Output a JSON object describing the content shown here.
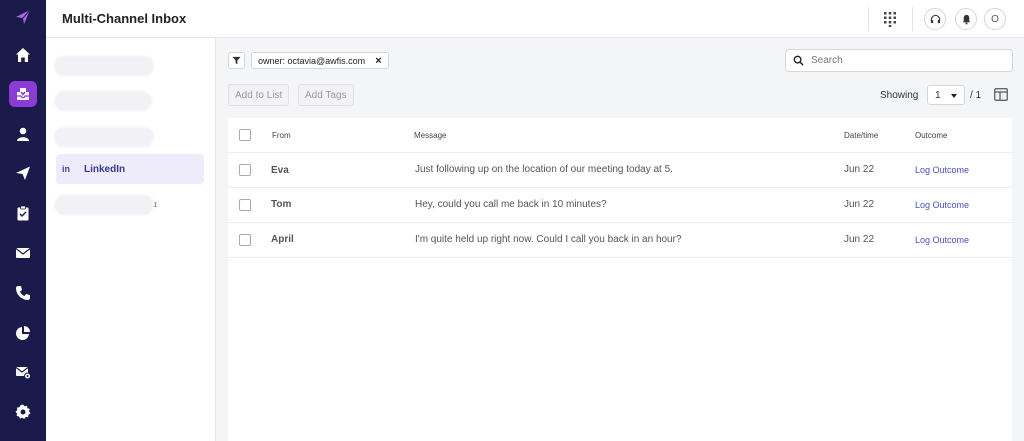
{
  "app": {
    "title": "Multi-Channel Inbox"
  },
  "rail": {
    "items": [
      "logo-icon",
      "home-icon",
      "inbox-icon",
      "contacts-icon",
      "send-icon",
      "clipboard-icon",
      "mail-icon",
      "phone-icon",
      "reports-icon",
      "mail-settings-icon",
      "settings-icon"
    ],
    "active": "inbox-icon",
    "accent": "#8b3bd6",
    "background": "#1b1b4b"
  },
  "topbar": {
    "avatar_initial": "O"
  },
  "sidebar": {
    "active_item": {
      "icon_text": "in",
      "label": "LinkedIn"
    },
    "trailing_fragment": "ɪ"
  },
  "filter": {
    "chip_label": "owner: octavia@awfis.com",
    "chip_remove": "×"
  },
  "search": {
    "placeholder": "Search"
  },
  "toolbar": {
    "add_to_list": "Add to List",
    "add_tags": "Add Tags",
    "showing_label": "Showing",
    "page_value": "1",
    "page_total": "/ 1"
  },
  "table": {
    "headers": {
      "from": "From",
      "message": "Message",
      "datetime": "Date/time",
      "outcome": "Outcome"
    },
    "rows": [
      {
        "from": "Eva",
        "message": "Just following up on the location of our meeting today at 5.",
        "date": "Jun 22",
        "outcome": "Log Outcome"
      },
      {
        "from": "Tom",
        "message": "Hey, could you call me back in 10 minutes?",
        "date": "Jun 22",
        "outcome": "Log Outcome"
      },
      {
        "from": "April",
        "message": "I'm quite held up right now. Could I call you back in an hour?",
        "date": "Jun 22",
        "outcome": "Log Outcome"
      }
    ]
  }
}
